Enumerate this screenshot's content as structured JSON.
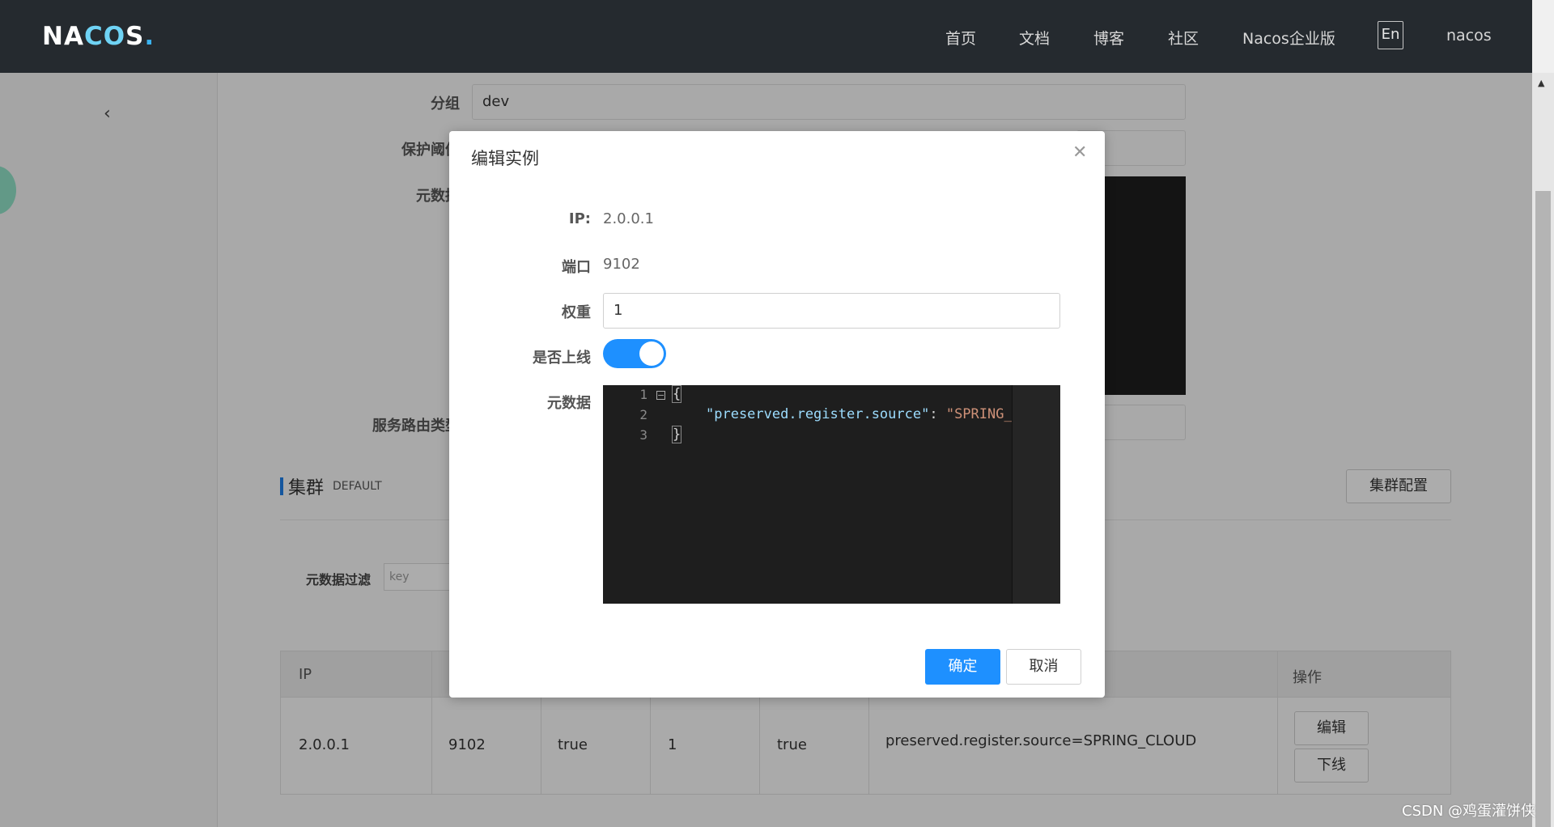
{
  "header": {
    "logo": {
      "part1": "NA",
      "part2": "CO",
      "part3": "S",
      "dot": "."
    },
    "nav": [
      "首页",
      "文档",
      "博客",
      "社区",
      "Nacos企业版"
    ],
    "lang": "En",
    "user": "nacos"
  },
  "background_form": {
    "group_label": "分组",
    "group_value": "dev",
    "threshold_label": "保护阈值",
    "metadata_label": "元数据",
    "route_label": "服务路由类型"
  },
  "cluster": {
    "title": "集群",
    "name": "DEFAULT",
    "config_button": "集群配置",
    "filter_label": "元数据过滤",
    "filter_placeholder": "key"
  },
  "table": {
    "headers": [
      "IP",
      "",
      "",
      "",
      "",
      "",
      "操作"
    ],
    "rows": [
      {
        "ip": "2.0.0.1",
        "port": "9102",
        "ephemeral": "true",
        "weight": "1",
        "healthy": "true",
        "metadata": "preserved.register.source=SPRING_CLOUD",
        "actions": [
          "编辑",
          "下线"
        ]
      }
    ]
  },
  "dialog": {
    "title": "编辑实例",
    "ip_label": "IP:",
    "ip_value": "2.0.0.1",
    "port_label": "端口",
    "port_value": "9102",
    "weight_label": "权重",
    "weight_value": "1",
    "online_label": "是否上线",
    "online_value": true,
    "metadata_label": "元数据",
    "editor": {
      "line_numbers": [
        "1",
        "2",
        "3"
      ],
      "open_brace": "{",
      "key": "\"preserved.register.source\"",
      "colon": ": ",
      "value": "\"SPRING_",
      "close_brace": "}"
    },
    "ok_button": "确定",
    "cancel_button": "取消"
  },
  "watermark": "CSDN @鸡蛋灌饼侠"
}
